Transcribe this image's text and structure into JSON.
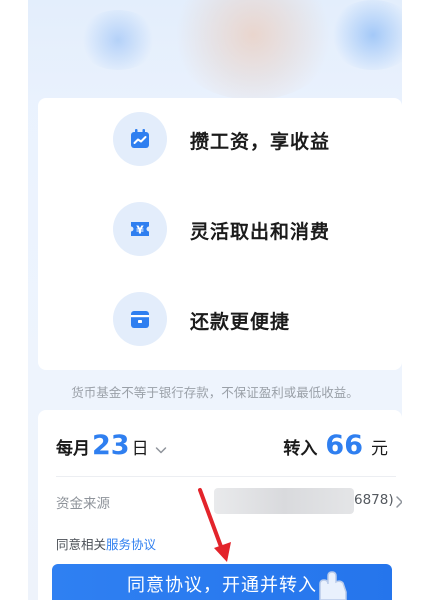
{
  "features": [
    {
      "label": "攒工资，享收益",
      "icon": "calendar-chart-icon"
    },
    {
      "label": "灵活取出和消费",
      "icon": "yuan-ticket-icon"
    },
    {
      "label": "还款更便捷",
      "icon": "card-icon"
    }
  ],
  "disclaimer": "货币基金不等于银行存款，不保证盈利或最低收益。",
  "plan": {
    "day_prefix": "每月",
    "day_value": "23",
    "day_suffix": "日",
    "amount_prefix": "转入",
    "amount_value": "66",
    "amount_unit": "元",
    "source_label": "资金来源",
    "source_account": "6878)",
    "agreement_prefix": "同意相关",
    "agreement_link": "服务协议",
    "confirm_label": "同意协议，开通并转入"
  },
  "colors": {
    "accent": "#2f7ff0",
    "annotation_arrow": "#e3242b"
  }
}
